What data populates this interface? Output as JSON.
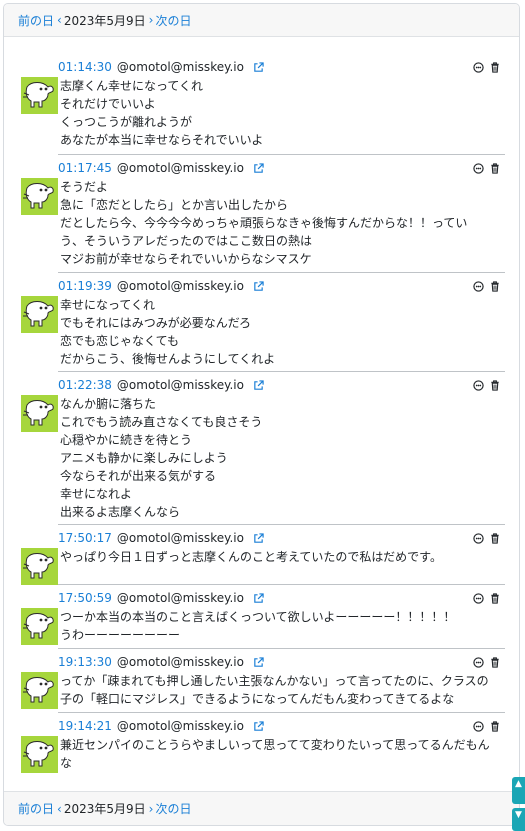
{
  "nav": {
    "prev_label": "前の日",
    "date": "2023年5月9日",
    "next_label": "次の日"
  },
  "colors": {
    "link": "#1a7fd6",
    "avatar_bg": "#a6d63c",
    "scroll_button": "#1aa6b5"
  },
  "posts": [
    {
      "time": "01:14:30",
      "user": "@omotol@misskey.io",
      "lines": [
        "志摩くん幸せになってくれ",
        "それだけでいいよ",
        "くっつこうが離れようが",
        "あなたが本当に幸せならそれでいいよ"
      ]
    },
    {
      "time": "01:17:45",
      "user": "@omotol@misskey.io",
      "lines": [
        "そうだよ",
        "急に「恋だとしたら」とか言い出したから",
        "だとしたら今、今今今今めっちゃ頑張らなきゃ後悔すんだからな！！ってい",
        "う、そういうアレだったのではここ数日の熱は",
        "マジお前が幸せならそれでいいからなシマスケ"
      ]
    },
    {
      "time": "01:19:39",
      "user": "@omotol@misskey.io",
      "lines": [
        "幸せになってくれ",
        "でもそれにはみつみが必要なんだろ",
        "恋でも恋じゃなくても",
        "だからこう、後悔せんようにしてくれよ"
      ]
    },
    {
      "time": "01:22:38",
      "user": "@omotol@misskey.io",
      "lines": [
        "なんか腑に落ちた",
        "これでもう読み直さなくても良さそう",
        "心穏やかに続きを待とう",
        "アニメも静かに楽しみにしよう",
        "今ならそれが出来る気がする",
        "幸せになれよ",
        "出来るよ志摩くんなら"
      ]
    },
    {
      "time": "17:50:17",
      "user": "@omotol@misskey.io",
      "lines": [
        "やっぱり今日１日ずっと志摩くんのこと考えていたので私はだめです。"
      ]
    },
    {
      "time": "17:50:59",
      "user": "@omotol@misskey.io",
      "lines": [
        "つーか本当の本当のこと言えばくっついて欲しいよーーーーー！！！！！",
        "うわーーーーーーーー"
      ]
    },
    {
      "time": "19:13:30",
      "user": "@omotol@misskey.io",
      "lines": [
        "ってか「疎まれても押し通したい主張なんかない」って言ってたのに、クラスの",
        "子の「軽口にマジレス」できるようになってんだもん変わってきてるよな"
      ]
    },
    {
      "time": "19:14:21",
      "user": "@omotol@misskey.io",
      "lines": [
        "兼近センパイのことうらやましいって思ってて変わりたいって思ってるんだもん",
        "な"
      ]
    }
  ]
}
